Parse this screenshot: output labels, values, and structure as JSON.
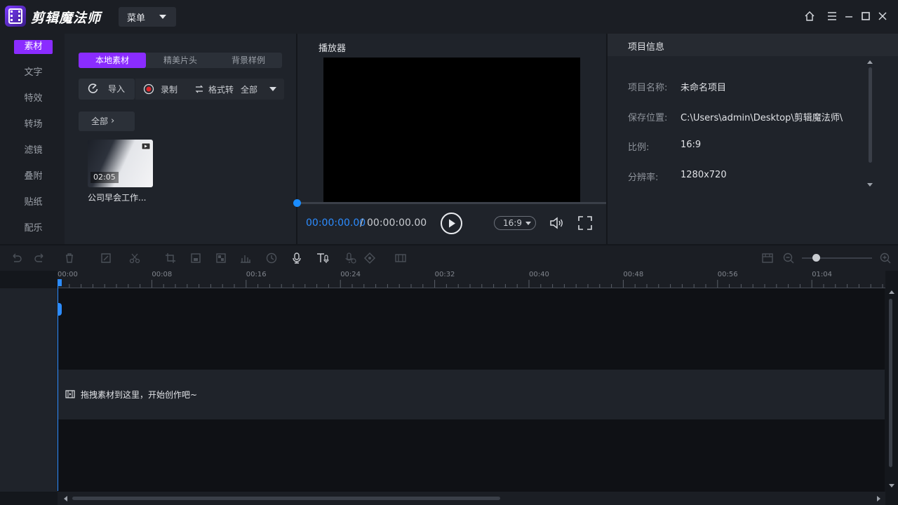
{
  "app": {
    "title": "剪辑魔法师",
    "menu_label": "菜单"
  },
  "window_controls": [
    "home-icon",
    "hamburger-icon",
    "minimize-icon",
    "maximize-icon",
    "close-icon"
  ],
  "sidebar": {
    "items": [
      {
        "label": "素材",
        "active": true
      },
      {
        "label": "文字",
        "active": false
      },
      {
        "label": "特效",
        "active": false
      },
      {
        "label": "转场",
        "active": false
      },
      {
        "label": "滤镜",
        "active": false
      },
      {
        "label": "叠附",
        "active": false
      },
      {
        "label": "贴纸",
        "active": false
      },
      {
        "label": "配乐",
        "active": false
      }
    ]
  },
  "material": {
    "tabs": [
      {
        "label": "本地素材",
        "active": true
      },
      {
        "label": "精美片头",
        "active": false
      },
      {
        "label": "背景样例",
        "active": false
      }
    ],
    "import_label": "导入",
    "record_label": "录制",
    "convert_label": "格式转",
    "convert_filter": "全部",
    "filter_all_label": "全部",
    "items": [
      {
        "duration": "02:05",
        "name": "公司早会工作..."
      }
    ]
  },
  "player": {
    "title": "播放器",
    "time_current": "00:00:00.00",
    "time_separator": "/",
    "time_total": "00:00:00.00",
    "ratio": "16:9",
    "progress": 0
  },
  "project": {
    "title": "项目信息",
    "fields": [
      {
        "label": "项目名称:",
        "value": "未命名项目"
      },
      {
        "label": "保存位置:",
        "value": "C:\\Users\\admin\\Desktop\\剪辑魔法师\\"
      },
      {
        "label": "比例:",
        "value": "16:9"
      },
      {
        "label": "分辨率:",
        "value": "1280x720"
      }
    ]
  },
  "timeline": {
    "ticks": [
      "00:00",
      "00:08",
      "00:16",
      "00:24",
      "00:32",
      "00:40",
      "00:48",
      "00:56",
      "01:04"
    ],
    "drop_hint": "拖拽素材到这里，开始创作吧~",
    "zoom": 0.2
  },
  "colors": {
    "accent": "#8a2cff",
    "playhead": "#2c8cff"
  }
}
